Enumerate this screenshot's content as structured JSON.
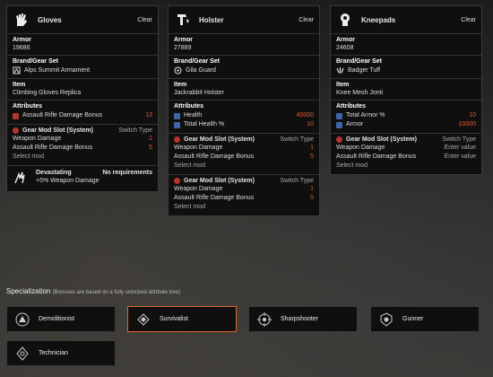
{
  "cards": [
    {
      "title": "Gloves",
      "clear_label": "Clear",
      "armor_label": "Armor",
      "armor_value": "19686",
      "brand_label": "Brand/Gear Set",
      "brand_value": "Alps Summit Armament",
      "item_label": "Item",
      "item_value": "Climbing Gloves Replica",
      "attributes_label": "Attributes",
      "attributes": [
        {
          "name": "Assault Rifle Damage Bonus",
          "value": "13"
        }
      ],
      "gear_mods": [
        {
          "title": "Gear Mod Slot (System)",
          "switch_label": "Switch Type",
          "stats": [
            {
              "name": "Weapon Damage",
              "value": "1"
            },
            {
              "name": "Assault Rifle Damage Bonus",
              "value": "5"
            }
          ],
          "select_label": "Select mod"
        }
      ],
      "talent": {
        "name": "Devastating",
        "requirement": "No requirements",
        "description": "+5% Weapon Damage"
      }
    },
    {
      "title": "Holster",
      "clear_label": "Clear",
      "armor_label": "Armor",
      "armor_value": "27889",
      "brand_label": "Brand/Gear Set",
      "brand_value": "Gila Guard",
      "item_label": "Item",
      "item_value": "Jackrabbit Holster",
      "attributes_label": "Attributes",
      "attributes": [
        {
          "name": "Health",
          "value": "40000"
        },
        {
          "name": "Total Health %",
          "value": "10"
        }
      ],
      "gear_mods": [
        {
          "title": "Gear Mod Slot (System)",
          "switch_label": "Switch Type",
          "stats": [
            {
              "name": "Weapon Damage",
              "value": "1"
            },
            {
              "name": "Assault Rifle Damage Bonus",
              "value": "5"
            }
          ],
          "select_label": "Select mod"
        },
        {
          "title": "Gear Mod Slot (System)",
          "switch_label": "Switch Type",
          "stats": [
            {
              "name": "Weapon Damage",
              "value": "1"
            },
            {
              "name": "Assault Rifle Damage Bonus",
              "value": "5"
            }
          ],
          "select_label": "Select mod"
        }
      ]
    },
    {
      "title": "Kneepads",
      "clear_label": "Clear",
      "armor_label": "Armor",
      "armor_value": "24608",
      "brand_label": "Brand/Gear Set",
      "brand_value": "Badger Tuff",
      "item_label": "Item",
      "item_value": "Knee Mesh Jonti",
      "attributes_label": "Attributes",
      "attributes": [
        {
          "name": "Total Armor %",
          "value": "10"
        },
        {
          "name": "Armor",
          "value": "10000"
        }
      ],
      "gear_mods": [
        {
          "title": "Gear Mod Slot (System)",
          "switch_label": "Switch Type",
          "stats": [
            {
              "name": "Weapon Damage",
              "value": "Enter value"
            },
            {
              "name": "Assault Rifle Damage Bonus",
              "value": "Enter value"
            }
          ],
          "select_label": "Select mod"
        }
      ]
    }
  ],
  "specialization": {
    "title": "Specialization",
    "note": "(Bonuses are based on a fully unlocked attribute tree)",
    "selected": "Survivalist",
    "options": [
      {
        "label": "Demolitionist",
        "icon": "demolitionist-icon"
      },
      {
        "label": "Survivalist",
        "icon": "survivalist-icon"
      },
      {
        "label": "Sharpshooter",
        "icon": "sharpshooter-icon"
      },
      {
        "label": "Gunner",
        "icon": "gunner-icon"
      },
      {
        "label": "Technician",
        "icon": "technician-icon"
      }
    ]
  },
  "colors": {
    "accent": "#e0632d",
    "value_red": "#e05a3a",
    "mod_dot": "#b2362c",
    "attr_blue": "#3f66a8"
  }
}
